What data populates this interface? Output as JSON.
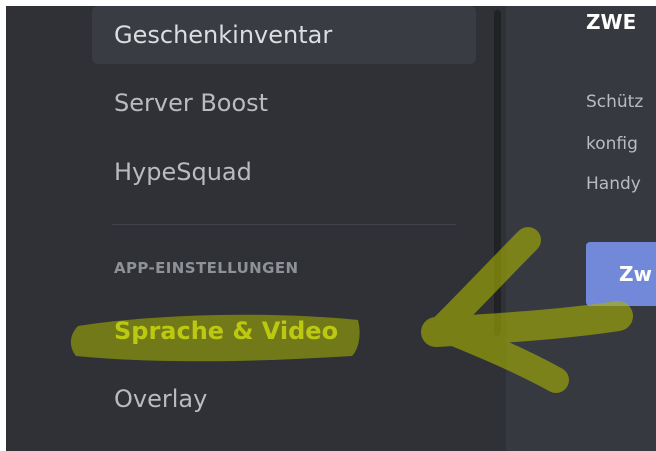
{
  "sidebar": {
    "items": [
      {
        "label": "Geschenkinventar"
      },
      {
        "label": "Server Boost"
      },
      {
        "label": "HypeSquad"
      },
      {
        "label": "Sprache & Video"
      },
      {
        "label": "Overlay"
      }
    ],
    "section_header": "APP-EINSTELLUNGEN"
  },
  "content": {
    "title": "ZWE",
    "text_lines": [
      "Schütz",
      "konfig",
      "Handy"
    ],
    "button_label": "Zw"
  },
  "colors": {
    "sidebar_bg": "#2f3136",
    "content_bg": "#36393f",
    "highlight_text": "#d6e024",
    "highlighter_marker": "#a9b400",
    "accent": "#7289da"
  },
  "icons": {
    "annotation": "hand-drawn-arrow-icon"
  }
}
